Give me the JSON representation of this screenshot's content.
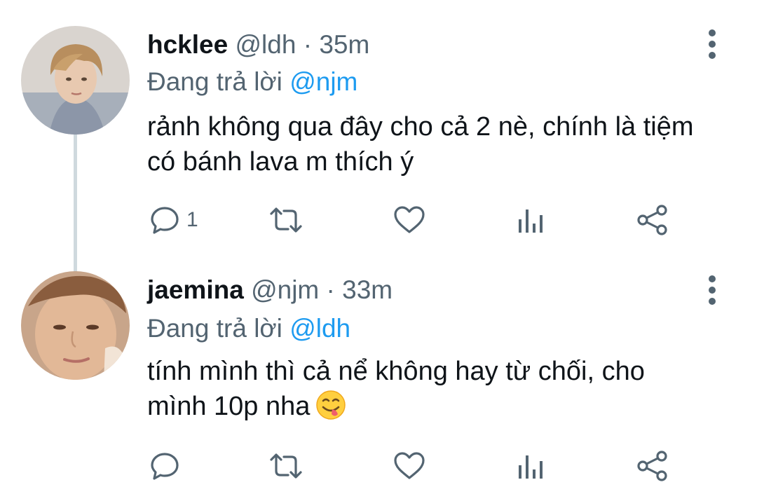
{
  "colors": {
    "accent": "#1d9bf0",
    "secondary_text": "#536471",
    "primary_text": "#0f1419",
    "thread_line": "#cfd9de"
  },
  "tweets": [
    {
      "display_name": "hcklee",
      "handle": "@ldh",
      "separator": "·",
      "time": "35m",
      "reply_prefix": "Đang trả lời",
      "reply_to": "@njm",
      "text": "rảnh không qua đây cho cả 2 nè, chính là tiệm có bánh lava m thích ý",
      "reply_count": "1",
      "icons": [
        "reply-icon",
        "retweet-icon",
        "like-icon",
        "views-icon",
        "share-icon",
        "more-icon"
      ]
    },
    {
      "display_name": "jaemina",
      "handle": "@njm",
      "separator": "·",
      "time": "33m",
      "reply_prefix": "Đang trả lời",
      "reply_to": "@ldh",
      "text": "tính mình thì cả nể không hay từ chối, cho mình 10p nha",
      "emoji": "face-savoring-food-emoji",
      "reply_count": "",
      "icons": [
        "reply-icon",
        "retweet-icon",
        "like-icon",
        "views-icon",
        "share-icon",
        "more-icon"
      ]
    }
  ]
}
